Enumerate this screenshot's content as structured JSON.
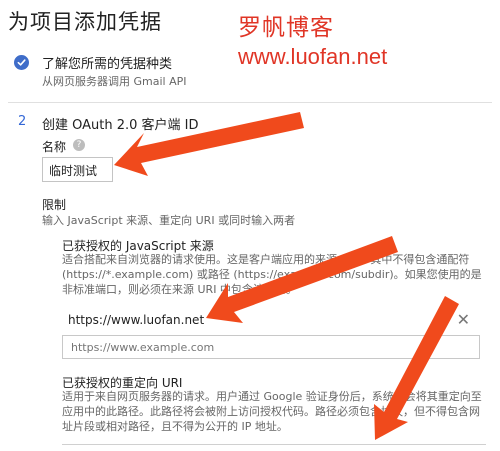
{
  "page": {
    "title": "为项目添加凭据"
  },
  "watermark": {
    "cn": "罗帆博客",
    "url": "www.luofan.net",
    "color": "#e03526"
  },
  "step1": {
    "title": "了解您所需的凭据种类",
    "subtitle": "从网页服务器调用 Gmail API"
  },
  "step2": {
    "number": "2",
    "title": "创建 OAuth 2.0 客户端 ID",
    "name_label": "名称",
    "name_value": "临时测试",
    "restrict_label": "限制",
    "restrict_desc": "输入 JavaScript 来源、重定向 URI 或同时输入两者",
    "js_origins": {
      "title": "已获授权的 JavaScript 来源",
      "desc": "适合搭配来自浏览器的请求使用。这是客户端应用的来源 URI，其中不得包含通配符 (https://*.example.com) 或路径 (https://example.com/subdir)。如果您使用的是非标准端口，则必须在来源 URI 中包含该端口。",
      "value": "https://www.luofan.net",
      "placeholder": "https://www.example.com"
    },
    "redirect_uris": {
      "title": "已获授权的重定向 URI",
      "desc": "适用于来自网页服务器的请求。用户通过 Google 验证身份后，系统就会将其重定向至应用中的此路径。此路径将会被附上访问授权代码。路径必须包含协议，但不得包含网址片段或相对路径，且不得为公开的 IP 地址。"
    }
  },
  "colors": {
    "accent": "#3367d6",
    "check": "#3f6dc9",
    "arrow": "#f04a1c"
  },
  "icons": {
    "check": "check-circle-icon",
    "help": "help-icon",
    "close": "close-icon"
  }
}
